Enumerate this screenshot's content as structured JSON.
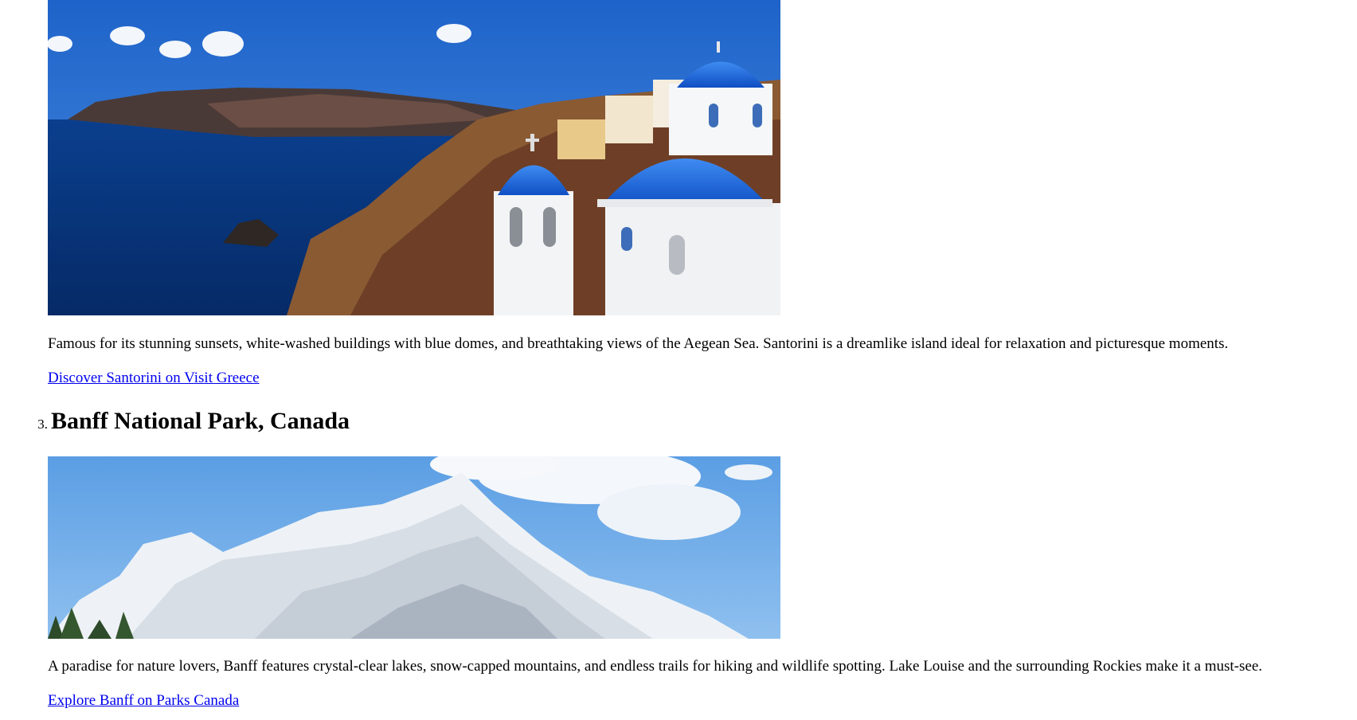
{
  "destinations": [
    {
      "image_alt": "Santorini blue domes over the Aegean Sea",
      "description": "Famous for its stunning sunsets, white-washed buildings with blue domes, and breathtaking views of the Aegean Sea. Santorini is a dreamlike island ideal for relaxation and picturesque moments.",
      "link_text": "Discover Santorini on Visit Greece"
    },
    {
      "number": "3.",
      "title": "Banff National Park, Canada",
      "image_alt": "Snow-capped mountains in Banff",
      "description": "A paradise for nature lovers, Banff features crystal-clear lakes, snow-capped mountains, and endless trails for hiking and wildlife spotting. Lake Louise and the surrounding Rockies make it a must-see.",
      "link_text": "Explore Banff on Parks Canada"
    }
  ],
  "colors": {
    "link": "#0000ee",
    "text": "#000000",
    "background": "#ffffff"
  }
}
